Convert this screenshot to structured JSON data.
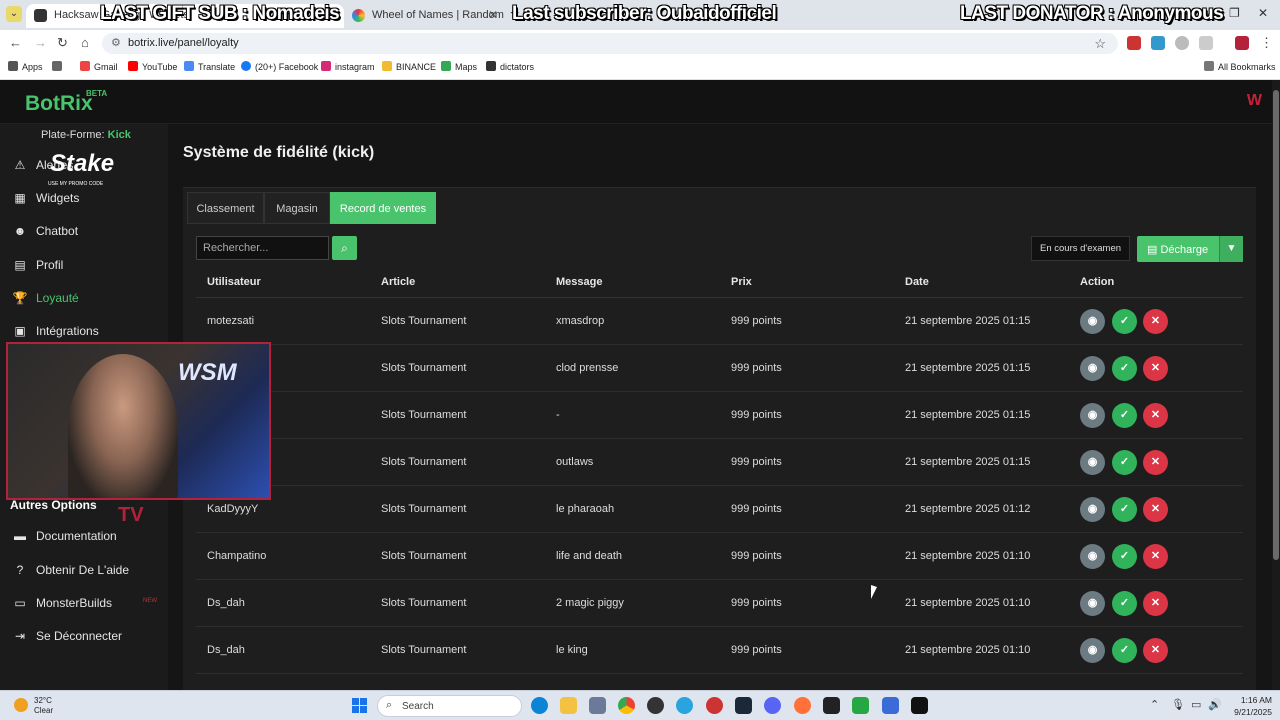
{
  "browser": {
    "tabs": [
      {
        "label": "Hacksaw Gaming | Widgets"
      },
      {
        "label": "Wheel of Names | Random nam"
      }
    ],
    "url": "botrix.live/panel/loyalty",
    "bookmarks": [
      "Apps",
      "Gmail",
      "YouTube",
      "Translate",
      "(20+) Facebook",
      "instagram",
      "BINANCE",
      "Maps",
      "dictators"
    ],
    "all_bookmarks": "All Bookmarks"
  },
  "stream_overlay": {
    "last_gift": "LAST GIFT SUB : Nomadeis",
    "last_subscriber": "Last subscriber: Oubaidofficiel",
    "last_donator": "LAST DONATOR : Anonymous"
  },
  "app": {
    "logo": "BotRix",
    "beta": "BETA",
    "brand_mark": "W",
    "platform_label": "Plate-Forme:",
    "platform_value": "Kick",
    "stake_logo": "Stake",
    "stake_sub": "USE MY PROMO CODE",
    "nav": [
      {
        "label": "Alertes",
        "icon": "warning-icon"
      },
      {
        "label": "Widgets",
        "icon": "widgets-icon"
      },
      {
        "label": "Chatbot",
        "icon": "robot-icon"
      },
      {
        "label": "Profil",
        "icon": "profile-icon"
      },
      {
        "label": "Loyauté",
        "icon": "trophy-icon"
      },
      {
        "label": "Intégrations",
        "icon": "integrations-icon"
      }
    ],
    "other_section": "Autres Options",
    "nav_other": [
      {
        "label": "Documentation",
        "icon": "book-icon"
      },
      {
        "label": "Obtenir De L'aide",
        "icon": "help-icon"
      },
      {
        "label": "MonsterBuilds",
        "icon": "monitor-icon"
      },
      {
        "label": "Se Déconnecter",
        "icon": "logout-icon"
      }
    ],
    "new_badge": "NEW",
    "webcam_text": "WSM",
    "tv_logo": "TV"
  },
  "page": {
    "title": "Système de fidélité (kick)",
    "tabs": [
      "Classement",
      "Magasin",
      "Record de ventes"
    ],
    "active_tab": 2,
    "search_placeholder": "Rechercher...",
    "status_filter": "En cours d'examen",
    "download_label": "Décharge",
    "columns": [
      "Utilisateur",
      "Article",
      "Message",
      "Prix",
      "Date",
      "Action"
    ],
    "rows": [
      {
        "user": "motezsati",
        "item": "Slots Tournament",
        "message": "xmasdrop",
        "price": "999 points",
        "date": "21 septembre 2025 01:15"
      },
      {
        "user": "",
        "item": "Slots Tournament",
        "message": "clod prensse",
        "price": "999 points",
        "date": "21 septembre 2025 01:15"
      },
      {
        "user": "",
        "item": "Slots Tournament",
        "message": "-",
        "price": "999 points",
        "date": "21 septembre 2025 01:15"
      },
      {
        "user": "",
        "item": "Slots Tournament",
        "message": "outlaws",
        "price": "999 points",
        "date": "21 septembre 2025 01:15"
      },
      {
        "user": "KadDyyyY",
        "item": "Slots Tournament",
        "message": "le pharaoah",
        "price": "999 points",
        "date": "21 septembre 2025 01:12"
      },
      {
        "user": "Champatino",
        "item": "Slots Tournament",
        "message": "life and death",
        "price": "999 points",
        "date": "21 septembre 2025 01:10"
      },
      {
        "user": "Ds_dah",
        "item": "Slots Tournament",
        "message": "2 magic piggy",
        "price": "999 points",
        "date": "21 septembre 2025 01:10"
      },
      {
        "user": "Ds_dah",
        "item": "Slots Tournament",
        "message": "le king",
        "price": "999 points",
        "date": "21 septembre 2025 01:10"
      }
    ]
  },
  "taskbar": {
    "temperature": "32°C",
    "weather": "Clear",
    "search_label": "Search",
    "time": "1:16 AM",
    "date": "9/21/2025"
  },
  "colors": {
    "accent": "#49c46c",
    "danger": "#dc3545",
    "view": "#6c7a82"
  }
}
